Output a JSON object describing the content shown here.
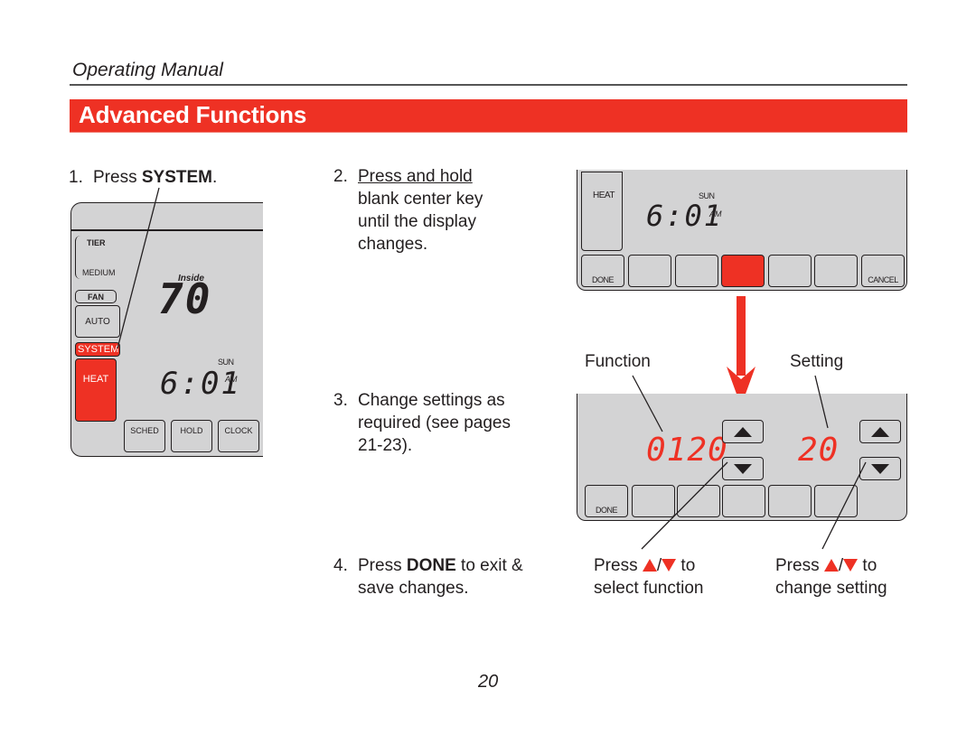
{
  "header": {
    "manual_title": "Operating Manual",
    "section_title": "Advanced Functions",
    "accent_color": "#ee3124"
  },
  "steps": [
    {
      "number": "1.",
      "pre": "Press ",
      "bold": "SYSTEM",
      "post": "."
    },
    {
      "number": "2.",
      "underlined": "Press and hold",
      "lines": [
        "blank center key",
        "until the display",
        "changes."
      ]
    },
    {
      "number": "3.",
      "lines": [
        "Change settings as",
        "required (see pages",
        "21-23)."
      ]
    },
    {
      "number": "4.",
      "pre": "Press ",
      "bold": "DONE",
      "post": " to exit &",
      "line2": "save changes."
    }
  ],
  "thermostat_home": {
    "fan_speed_labels": [
      "TIER",
      "MEDIUM"
    ],
    "fan_button": "FAN",
    "fan_mode": "AUTO",
    "system_button": "SYSTEM",
    "system_mode": "HEAT",
    "inside_label": "Inside",
    "inside_temp": "70",
    "day": "SUN",
    "time": "6:01",
    "ampm": "AM",
    "bottom_keys": [
      "SCHED",
      "HOLD",
      "CLOCK"
    ]
  },
  "thermostat_hold": {
    "system_mode": "HEAT",
    "day": "SUN",
    "time": "6:01",
    "ampm": "AM",
    "keys": [
      "DONE",
      "",
      "",
      "",
      "",
      "",
      "CANCEL"
    ],
    "highlighted_key_index": 3
  },
  "thermostat_installer": {
    "function_label": "Function",
    "setting_label": "Setting",
    "function_value": "0120",
    "setting_value": "20",
    "keys": [
      "DONE",
      "",
      "",
      "",
      "",
      ""
    ]
  },
  "callouts": {
    "function_hint_line1": "Press",
    "function_hint_line1_end": "to",
    "function_hint_line2": "select function",
    "setting_hint_line1": "Press",
    "setting_hint_line1_end": "to",
    "setting_hint_line2": "change setting"
  },
  "footer": {
    "page_number": "20"
  }
}
